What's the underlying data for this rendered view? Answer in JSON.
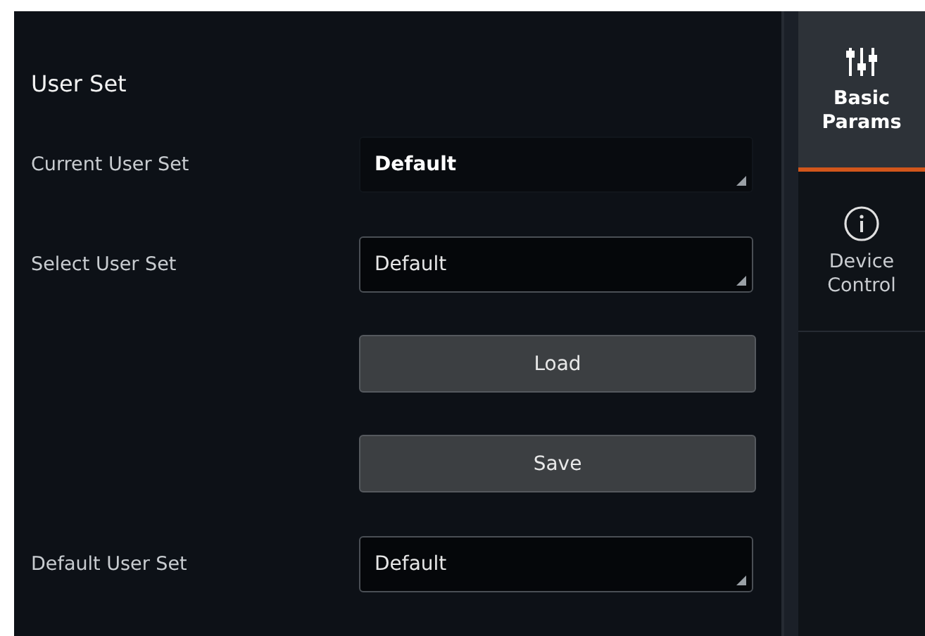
{
  "section_title": "User Set",
  "rows": [
    {
      "kind": "dropdown",
      "label": "Current User Set",
      "value": "Default",
      "disabled": true
    },
    {
      "kind": "dropdown",
      "label": "Select User Set",
      "value": "Default",
      "disabled": false
    },
    {
      "kind": "button",
      "text": "Load"
    },
    {
      "kind": "button",
      "text": "Save"
    },
    {
      "kind": "dropdown",
      "label": "Default User Set",
      "value": "Default",
      "disabled": false
    }
  ],
  "tabs": [
    {
      "kind": "sliders",
      "label": "Basic Params",
      "selected": true
    },
    {
      "kind": "info",
      "label": "Device Control",
      "selected": false
    }
  ]
}
